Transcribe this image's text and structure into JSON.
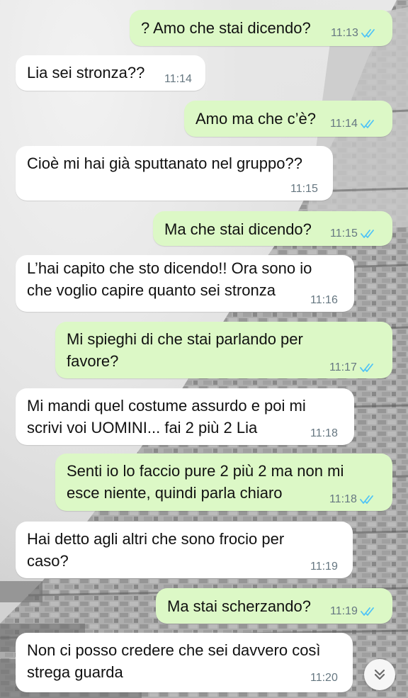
{
  "messages": [
    {
      "dir": "out",
      "lines": [
        "? Amo che stai dicendo?"
      ],
      "time": "11:13",
      "read": true
    },
    {
      "dir": "in",
      "lines": [
        "Lia sei stronza??"
      ],
      "time": "11:14"
    },
    {
      "dir": "out",
      "lines": [
        "Amo ma che c’è?"
      ],
      "time": "11:14",
      "read": true
    },
    {
      "dir": "in",
      "lines": [
        "Cioè mi hai già sputtanato nel gruppo??"
      ],
      "time": "11:15"
    },
    {
      "dir": "out",
      "lines": [
        "Ma che stai dicendo?"
      ],
      "time": "11:15",
      "read": true
    },
    {
      "dir": "in",
      "lines": [
        "L’hai capito che sto dicendo!! Ora sono io",
        "che voglio capire quanto sei stronza"
      ],
      "time": "11:16"
    },
    {
      "dir": "out",
      "lines": [
        "Mi spieghi di che stai parlando per",
        "favore?"
      ],
      "time": "11:17",
      "read": true
    },
    {
      "dir": "in",
      "lines": [
        "Mi mandi quel costume assurdo e poi mi",
        "scrivi voi UOMINI... fai 2 più 2 Lia"
      ],
      "time": "11:18"
    },
    {
      "dir": "out",
      "lines": [
        "Senti io lo faccio pure 2 più 2 ma non mi",
        "esce niente, quindi parla chiaro"
      ],
      "time": "11:18",
      "read": true
    },
    {
      "dir": "in",
      "lines": [
        "Hai detto agli altri che sono frocio per",
        "caso?"
      ],
      "time": "11:19"
    },
    {
      "dir": "out",
      "lines": [
        "Ma stai scherzando?"
      ],
      "time": "11:19",
      "read": true
    },
    {
      "dir": "in",
      "lines": [
        "Non ci posso credere che sei davvero così",
        "strega guarda"
      ],
      "time": "11:20"
    }
  ],
  "colors": {
    "incoming_bubble": "#ffffff",
    "outgoing_bubble": "#dcf8c6",
    "read_ticks": "#4fc3f7",
    "timestamp": "#667781"
  },
  "scroll_button": {
    "icon": "double-chevron-down-icon"
  }
}
